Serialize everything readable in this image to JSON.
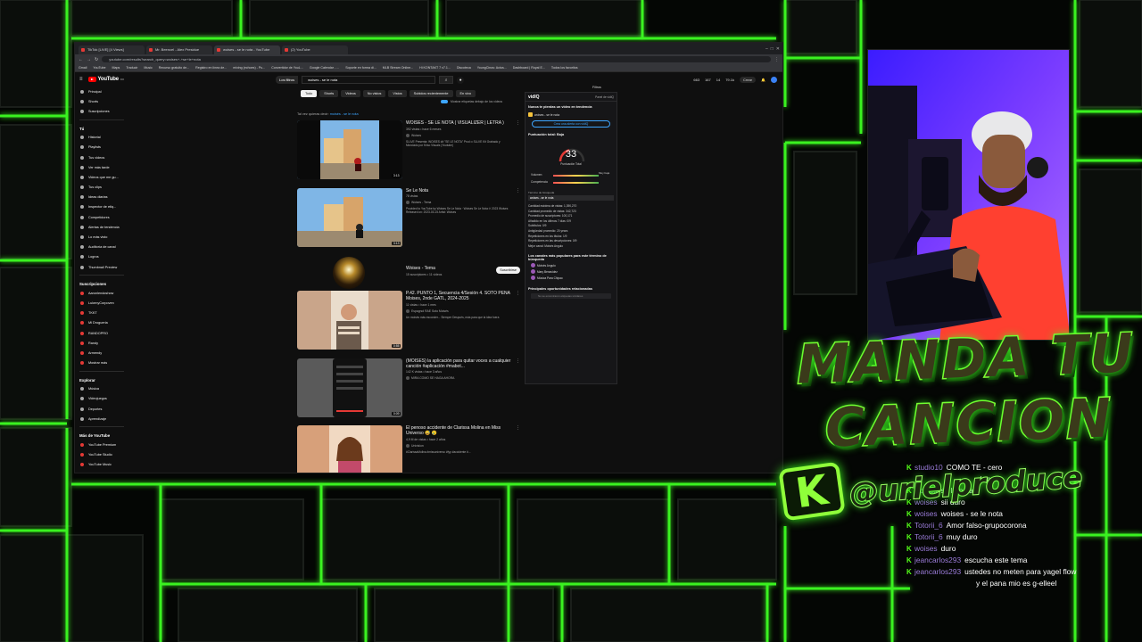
{
  "browser": {
    "tabs": [
      "TikTok [LIVE] [4 Views]",
      "Mr. Beencel - Alex Presidue",
      "woises - se le nota - YouTube",
      "(2) YouTube"
    ],
    "url": "youtube.com/results?search_query=woises+-+se+le+nota",
    "bookmarks": [
      "Gmail",
      "YouTube",
      "Maps",
      "Traducir",
      "Music",
      "Recurso gratuito de...",
      "Registro en línea de...",
      "mixing (echoes) - Pu...",
      "Convertidor de YouL...",
      "Google Calendar - ...",
      "Soporte en forma di...",
      "MLB Stream Online...",
      "Hi KONTAKT 7 v7.1...",
      "Discoteca",
      "YoungCinos: Actus...",
      "Dashboard | Royal E...",
      "Todos los favoritos"
    ]
  },
  "youtube": {
    "logo_region": "DO",
    "filter_chip": "Los filtros",
    "search_value": "woises - se le nota",
    "header_right": [
      "663",
      "11",
      "167",
      "11",
      "14",
      "79.1k",
      "Crear"
    ],
    "chips": [
      "Todo",
      "Shorts",
      "Videos",
      "No vistos",
      "Vistos",
      "Subidos recientemente",
      "En vivo"
    ],
    "toggle_label": "Mostrar etiquetas debajo de los videos",
    "suggest_prefix": "Tal vez quieras decir:",
    "suggest_term": "moisés - se le nota",
    "sidebar": {
      "main": [
        "Principal",
        "Shorts",
        "Suscripciones"
      ],
      "you_header": "Tú",
      "you": [
        "Historial",
        "Playlists",
        "Tus videos",
        "Ver más tarde",
        "Videos que me gu...",
        "Tus clips",
        "Ideas diarias",
        "Inspector de etiq...",
        "Competidores",
        "Alertas de tendencia",
        "Lo más visto",
        "Auditoría de canal",
        "Logros",
        "Thumbnail Preview"
      ],
      "subs_header": "Suscripciones",
      "subs": [
        "Aaronlendoshow",
        "LukenyCorpoven",
        "TKKT",
        "Mi Drogueria",
        "RANDOPRO",
        "Randy",
        "Armendy",
        "Mostrar más"
      ],
      "explore_header": "Explorar",
      "explore": [
        "Música",
        "Videojuegos",
        "Deportes",
        "Aprendizaje"
      ],
      "more_header": "Más de YouTube",
      "more": [
        "YouTube Premium",
        "YouTube Studio",
        "YouTube Music"
      ]
    },
    "results": [
      {
        "title": "WOISES - SE LE NOTA ( VISUALIZER | LETRA )",
        "meta": "392 vistas • hace 6 meses",
        "channel": "Woises",
        "desc": "SLLVE Presenta: WOISES ## \"SE LE NOTA\" Prod •• SLLVE Kit Grabado y Mezclado por Kriso Visuals (Youtube)",
        "duration": "3:13",
        "badge": "Solo"
      },
      {
        "title": "Se Le Nota",
        "meta": "78 vistas",
        "channel": "Woises - Tema",
        "desc": "Provided to YouTube by Woises Se Le Nota · Woises Se Le Nota ℗ 2023 Woises Released on: 2023-03-15 Artist: Woises",
        "duration": "3:13",
        "badge": "Mixer"
      }
    ],
    "channel": {
      "name": "Woises - Tema",
      "subs": "15 suscriptores • 11 videos",
      "subscribe_label": "Suscribirse"
    },
    "results_more": [
      {
        "title": "P.42. PUNTO 1, Secuencia 4/Sesión 4. SOTO PENA Moises, 2nde GATL, 2024-2025",
        "meta": "11 vistas • hace 1 mes",
        "channel": "Espagnol RAE Soto Moisés",
        "desc": "Un moisés más esconder... Siempre Después, más para que la idea fuera",
        "duration": "0:55"
      },
      {
        "title": "(MOISES) la aplicación para quitar voces a cualquier canción #aplicación #mabot...",
        "meta": "142 K vistas • hace 3 años",
        "channel": "MIRA COMO SE HAGA AHORA",
        "desc": "",
        "duration": "0:09"
      },
      {
        "title": "El penoso accidente de Clarissa Molina en Miss Universo 😅 😢",
        "meta": "4,9 M de vistas • hace 2 años",
        "channel": "Univision",
        "desc": "#ClarissaMolina #missuniverso #fyp #accidente #...",
        "duration": ""
      }
    ],
    "filters_label": "Filtros"
  },
  "vidiq": {
    "logo": "vidIQ",
    "panel_label": "Panel de vidIQ",
    "trend_title": "Nunca te pierdas un video en tendencia",
    "keyword": "woises - se le nota",
    "alert_btn": "Crea una alerta con vidIQ",
    "score_title": "Puntuación total: Baja",
    "score": "33",
    "score_label": "Puntuación Total",
    "volume_label": "Volumen",
    "volume_end": "Muy baja",
    "competition_label": "Competencia",
    "tabs": "Término de búsqueda",
    "kw_bar": "woises - se le nota",
    "stats": [
      "Cantidad máxima de vistas: 1,390,270",
      "Cantidad promedio de vistas: 342,723",
      "Promedio de suscriptores: 100,171",
      "Añadido en los últimos 7 días: 0/9",
      "Subtítulos: 0/9",
      "Antigüedad promedio: 20 years",
      "Repeticiones en los títulos: 1/9",
      "Repeticiones en las descripciones: 0/9",
      "Mejor canal: Moisés Angulo"
    ],
    "channels_title": "Los canales más populares para este término de búsqueda",
    "channels": [
      "Moisés Angulo",
      "Mary Benavidez",
      "Música Para Chipao"
    ],
    "opportunities_title": "Principales oportunidades relacionadas",
    "opportunities_input": "No se encontraron etiquetas similares"
  },
  "overlay": {
    "title_line1": "MANDA TU",
    "title_line2": "CANCION",
    "handle_icon": "K",
    "handle": "@urielproduce"
  },
  "chat": [
    {
      "user": "studio10",
      "text": "COMO TE - cero"
    },
    {
      "user": "",
      "text": "ahmo.."
    },
    {
      "user": "woises",
      "text": "se le nota"
    },
    {
      "user": "woises",
      "text": "sii duro"
    },
    {
      "user": "woises",
      "text": "woises - se le nota"
    },
    {
      "user": "Totorii_6",
      "text": "Amor falso-grupocorona"
    },
    {
      "user": "Totorii_6",
      "text": "muy duro"
    },
    {
      "user": "woises",
      "text": "duro"
    },
    {
      "user": "jeancarlos293",
      "text": "escucha este tema"
    },
    {
      "user": "jeancarlos293",
      "text": "ustedes no meten para yagel flow"
    },
    {
      "user": "",
      "text": "y el pana mio es g-elleel"
    }
  ],
  "colors": {
    "neon_green": "#53fc18",
    "kick_green": "#53fc18",
    "chat_user": "#9a7bd8",
    "yt_red": "#ff0000",
    "vidiq_blue": "#3ea6ff"
  },
  "icons": [
    "search-icon",
    "mic-icon",
    "bell-icon",
    "kick-logo-icon",
    "youtube-logo-icon"
  ]
}
